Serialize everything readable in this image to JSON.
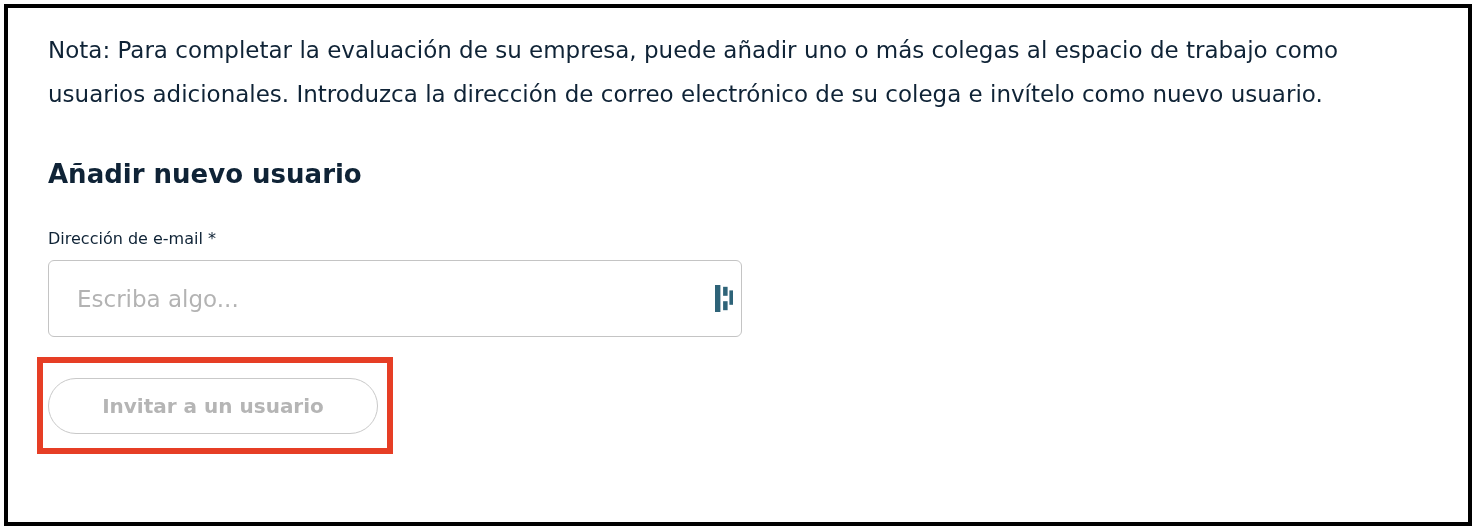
{
  "note": "Nota: Para completar la evaluación de su empresa, puede añadir uno o más colegas al espacio de trabajo como usuarios adicionales. Introduzca la dirección de correo electrónico de su colega e invítelo como nuevo usuario.",
  "heading": "Añadir nuevo usuario",
  "email_field": {
    "label": "Dirección de e-mail",
    "required_mark": "*",
    "placeholder": "Escriba algo..."
  },
  "invite_button": {
    "label": "Invitar a un usuario",
    "disabled": true,
    "highlighted": true
  }
}
